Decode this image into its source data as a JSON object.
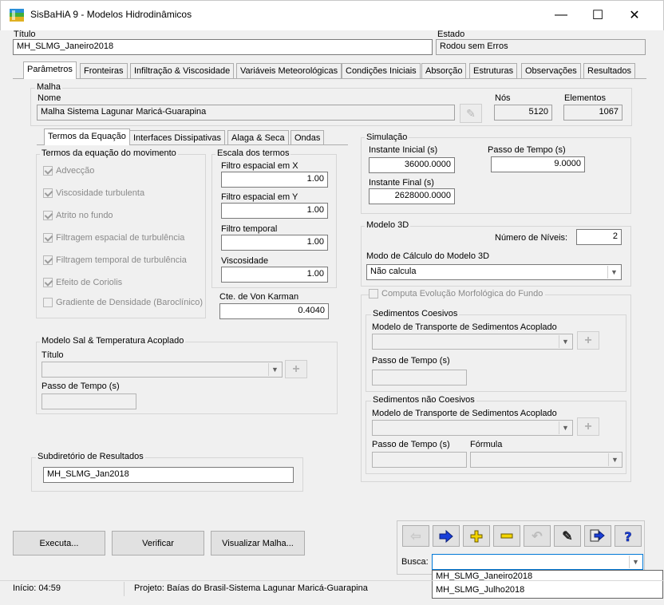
{
  "window": {
    "title": "SisBaHiA 9 - Modelos Hidrodinâmicos",
    "minimize_glyph": "—",
    "maximize_glyph": "☐",
    "close_glyph": "✕"
  },
  "header": {
    "titulo_label": "Título",
    "titulo_value": "MH_SLMG_Janeiro2018",
    "estado_label": "Estado",
    "estado_value": "Rodou sem Erros"
  },
  "tabs": [
    "Parâmetros",
    "Fronteiras",
    "Infiltração & Viscosidade",
    "Variáveis Meteorológicas",
    "Condições Iniciais",
    "Absorção",
    "Estruturas",
    "Observações",
    "Resultados"
  ],
  "malha": {
    "group": "Malha",
    "nome_label": "Nome",
    "nome_value": "Malha Sistema Lagunar Maricá-Guarapina",
    "nos_label": "Nós",
    "nos_value": "5120",
    "elementos_label": "Elementos",
    "elementos_value": "1067"
  },
  "subtabs": [
    "Termos da Equação",
    "Interfaces Dissipativas",
    "Alaga & Seca",
    "Ondas"
  ],
  "termos": {
    "group": "Termos da equação do movimento",
    "items": [
      {
        "label": "Advecção",
        "checked": true
      },
      {
        "label": "Viscosidade turbulenta",
        "checked": true
      },
      {
        "label": "Atrito no fundo",
        "checked": true
      },
      {
        "label": "Filtragem espacial de turbulência",
        "checked": true
      },
      {
        "label": "Filtragem temporal de turbulência",
        "checked": true
      },
      {
        "label": "Efeito de Coriolis",
        "checked": true
      },
      {
        "label": "Gradiente de Densidade (Baroclínico)",
        "checked": false
      }
    ]
  },
  "escala": {
    "group": "Escala dos termos",
    "filtro_x_label": "Filtro espacial em X",
    "filtro_x_value": "1.00",
    "filtro_y_label": "Filtro espacial em Y",
    "filtro_y_value": "1.00",
    "filtro_t_label": "Filtro temporal",
    "filtro_t_value": "1.00",
    "visc_label": "Viscosidade",
    "visc_value": "1.00",
    "karman_label": "Cte. de Von Karman",
    "karman_value": "0.4040"
  },
  "simulacao": {
    "group": "Simulação",
    "inicial_label": "Instante Inicial (s)",
    "inicial_value": "36000.0000",
    "passo_label": "Passo de Tempo (s)",
    "passo_value": "9.0000",
    "final_label": "Instante Final (s)",
    "final_value": "2628000.0000"
  },
  "modelo3d": {
    "group": "Modelo 3D",
    "niveis_label": "Número de Níveis:",
    "niveis_value": "2",
    "modo_label": "Modo de Cálculo do Modelo 3D",
    "modo_value": "Não calcula"
  },
  "morfo": {
    "checkbox_label": "Computa Evolução Morfológica do Fundo",
    "coesivos_group": "Sedimentos Coesivos",
    "coesivos_modelo_label": "Modelo de Transporte de Sedimentos Acoplado",
    "coesivos_passo_label": "Passo de Tempo (s)",
    "naocoesivos_group": "Sedimentos não Coesivos",
    "naocoesivos_modelo_label": "Modelo de Transporte de Sedimentos Acoplado",
    "naocoesivos_passo_label": "Passo de Tempo (s)",
    "formula_label": "Fórmula"
  },
  "salt": {
    "group": "Modelo Sal & Temperatura Acoplado",
    "titulo_label": "Título",
    "passo_label": "Passo de Tempo (s)"
  },
  "subdir": {
    "group": "Subdiretório de Resultados",
    "value": "MH_SLMG_Jan2018"
  },
  "buttons": {
    "executa": "Executa...",
    "verificar": "Verificar",
    "visualizar": "Visualizar Malha..."
  },
  "toolbar": {
    "colors": {
      "blue": "#1a3fd9",
      "yellow": "#f3d400",
      "gray": "#9a9a9a"
    }
  },
  "busca": {
    "label": "Busca:",
    "value": "",
    "options": [
      "MH_SLMG_Janeiro2018",
      "MH_SLMG_Julho2018"
    ]
  },
  "status": {
    "inicio": "Início: 04:59",
    "projeto": "Projeto: Baías do Brasil-Sistema Lagunar Maricá-Guarapina"
  }
}
